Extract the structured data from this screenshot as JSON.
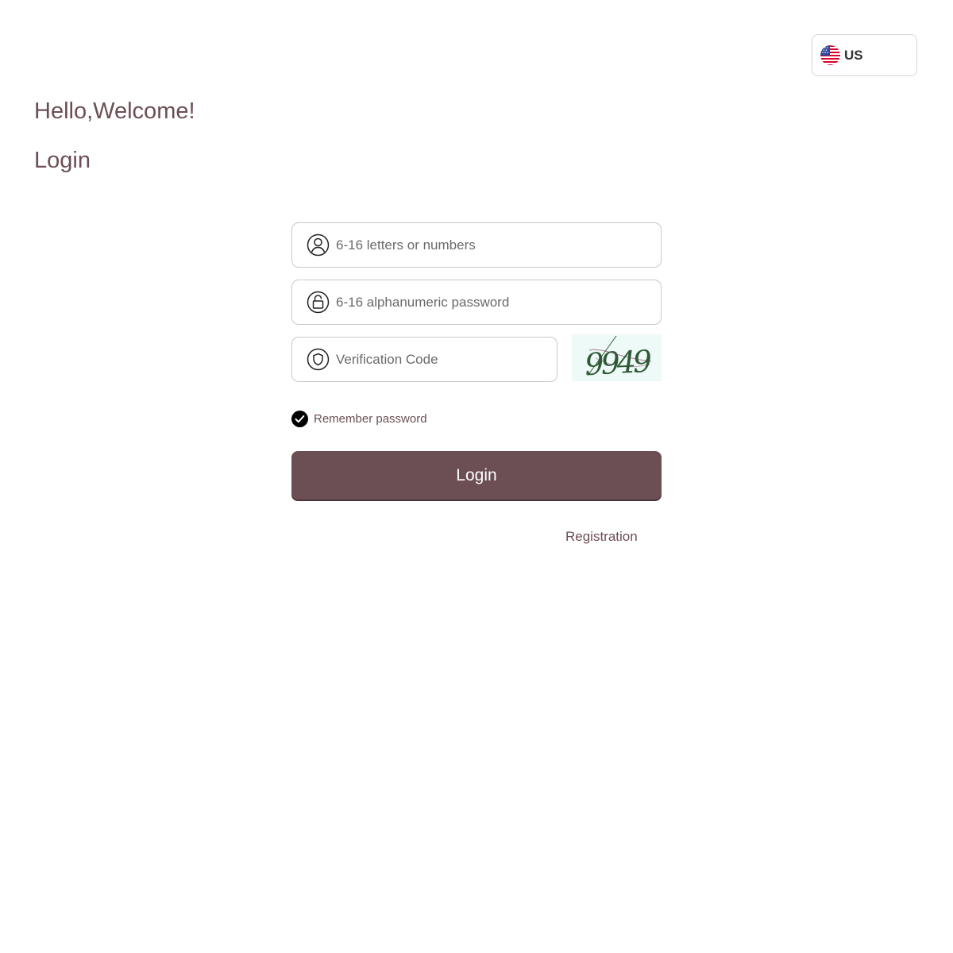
{
  "language": {
    "code_label": "US",
    "flag_icon": "us-flag-icon"
  },
  "greeting": {
    "welcome": "Hello,Welcome!",
    "heading": "Login"
  },
  "form": {
    "username": {
      "icon": "user-icon",
      "placeholder": "6-16 letters or numbers",
      "value": ""
    },
    "password": {
      "icon": "lock-icon",
      "placeholder": "6-16 alphanumeric password",
      "value": ""
    },
    "verification": {
      "icon": "shield-icon",
      "placeholder": "Verification Code",
      "value": ""
    },
    "captcha_text": "9949",
    "remember_label": "Remember password",
    "remember_checked": true,
    "submit_label": "Login",
    "registration_label": "Registration"
  },
  "colors": {
    "accent": "#6b4f55",
    "field_border": "#c8c8c8",
    "captcha_bg": "#eefaf8"
  }
}
